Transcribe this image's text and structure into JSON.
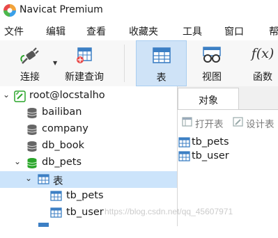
{
  "window": {
    "title": "Navicat Premium"
  },
  "menu": [
    "文件",
    "编辑",
    "查看",
    "收藏夹",
    "工具",
    "窗口",
    "帮"
  ],
  "toolbar": {
    "connect_label": "连接",
    "new_query_label": "新建查询",
    "table_label": "表",
    "view_label": "视图",
    "function_label": "函数",
    "function_glyph": "f(x)"
  },
  "tree": {
    "connection": "root@locstalho",
    "databases": [
      "bailiban",
      "company",
      "db_book",
      "db_pets"
    ],
    "tables_folder": "表",
    "tables": [
      "tb_pets",
      "tb_user"
    ]
  },
  "objects": {
    "tab_label": "对象",
    "open_table": "打开表",
    "design_table": "设计表",
    "items": [
      "tb_pets",
      "tb_user"
    ]
  },
  "watermark": "https://blog.csdn.net/qq_45607971",
  "colors": {
    "accent": "#1e7fd6",
    "selected": "#cce4fb",
    "db_active": "#2aa52a"
  }
}
